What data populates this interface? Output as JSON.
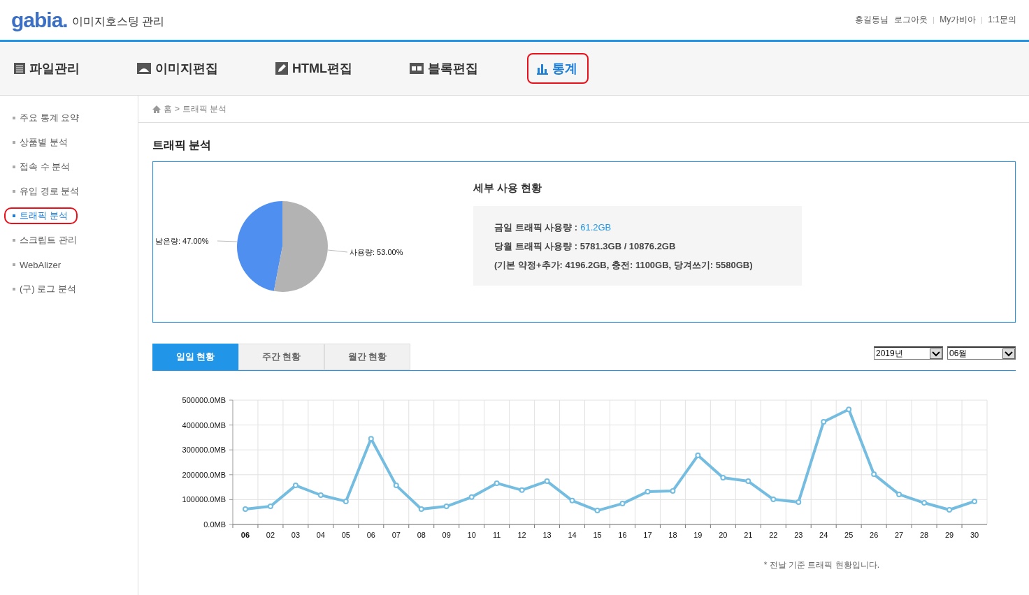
{
  "header": {
    "logo": "gabia.",
    "title": "이미지호스팅 관리",
    "links": [
      {
        "label": "홍길동님"
      },
      {
        "label": "로그아웃"
      },
      {
        "label": "My가비아"
      },
      {
        "label": "1:1문의"
      }
    ]
  },
  "nav": [
    {
      "label": "파일관리",
      "kind": "list",
      "selected": false
    },
    {
      "label": "이미지편집",
      "kind": "image",
      "selected": false
    },
    {
      "label": "HTML편집",
      "kind": "pencil",
      "selected": false
    },
    {
      "label": "블록편집",
      "kind": "blocks",
      "selected": false
    },
    {
      "label": "통계",
      "kind": "chart",
      "selected": true
    }
  ],
  "sidebar": {
    "items": [
      {
        "label": "주요 통계 요약",
        "selected": false
      },
      {
        "label": "상품별 분석",
        "selected": false
      },
      {
        "label": "접속 수 분석",
        "selected": false
      },
      {
        "label": "유입 경로 분석",
        "selected": false
      },
      {
        "label": "트래픽 분석",
        "selected": true
      },
      {
        "label": "스크립트 관리",
        "selected": false
      },
      {
        "label": "WebAlizer",
        "selected": false
      },
      {
        "label": "(구) 로그 분석",
        "selected": false
      }
    ]
  },
  "breadcrumb": [
    "홈",
    ">",
    "트래픽 분석"
  ],
  "page_title": "트래픽 분석",
  "usage": {
    "chart_data": {
      "type": "pie",
      "categories": [
        "남은량: 47.00%",
        "사용량: 53.00%"
      ],
      "values": [
        47,
        53
      ],
      "colors": [
        "#4f8fef",
        "#b3b3b3"
      ]
    },
    "detail_title": "세부 사용 현황",
    "lines": [
      {
        "label": "금일 트래픽 사용량 :",
        "value": "61.2GB"
      },
      {
        "label": "당월 트래픽 사용량 : 5781.3GB / 10876.2GB"
      },
      {
        "label": "(기본 약정+추가: 4196.2GB, 충전: 1100GB, 당겨쓰기: 5580GB)"
      }
    ]
  },
  "period_tabs": [
    {
      "label": "일일 현황",
      "selected": true
    },
    {
      "label": "주간 현황",
      "selected": false
    },
    {
      "label": "월간 현황",
      "selected": false
    }
  ],
  "year_select": "2019년",
  "month_select": "06월",
  "traffic": {
    "chart_data": {
      "type": "line",
      "categories": [
        "06",
        "02",
        "03",
        "04",
        "05",
        "06",
        "07",
        "08",
        "09",
        "10",
        "11",
        "12",
        "13",
        "14",
        "15",
        "16",
        "17",
        "18",
        "19",
        "20",
        "21",
        "22",
        "23",
        "24",
        "25",
        "26",
        "27",
        "28",
        "29",
        "30"
      ],
      "grid": true,
      "marker": true,
      "series": [
        {
          "color": "#74bde0",
          "values": [
            62000,
            73000,
            157000,
            118000,
            93000,
            345000,
            157000,
            62000,
            73000,
            110000,
            166000,
            138000,
            174000,
            96000,
            56000,
            84000,
            132000,
            135000,
            278000,
            188000,
            174000,
            101000,
            90000,
            413000,
            463000,
            202000,
            121000,
            87000,
            59000,
            93000
          ]
        }
      ],
      "ylim": [
        0,
        500000
      ],
      "yticks": [
        {
          "value": 0,
          "label": "0.0MB"
        },
        {
          "value": 100000,
          "label": "100000.0MB"
        },
        {
          "value": 200000,
          "label": "200000.0MB"
        },
        {
          "value": 300000,
          "label": "300000.0MB"
        },
        {
          "value": 400000,
          "label": "400000.0MB"
        },
        {
          "value": 500000,
          "label": "500000.0MB"
        }
      ]
    },
    "note": "* 전날 기준 트래픽 현황입니다."
  }
}
